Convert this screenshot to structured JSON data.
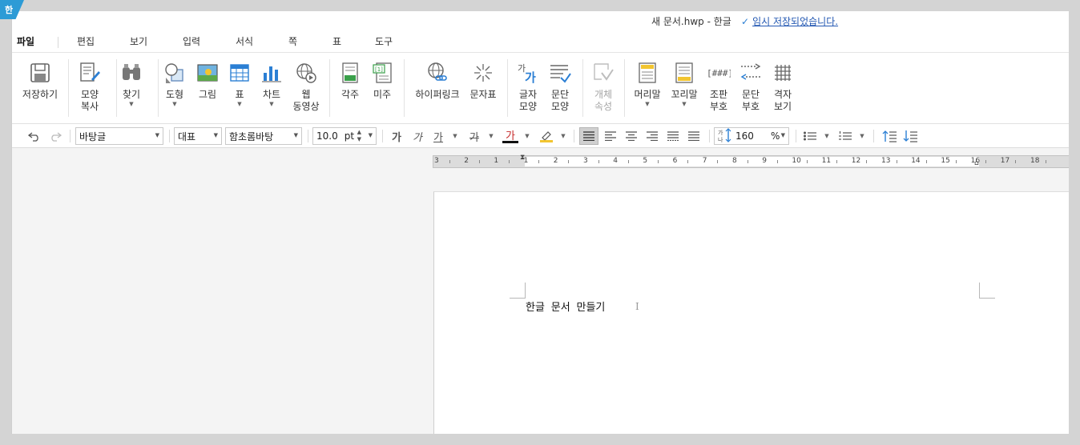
{
  "app": {
    "logo_text": "한"
  },
  "title": {
    "document": "새 문서.hwp - 한글",
    "save_status": "임시 저장되었습니다.",
    "accent_color": "#2d9bd6"
  },
  "menu": {
    "items": [
      {
        "label": "파일",
        "active": true
      },
      {
        "label": "편집"
      },
      {
        "label": "보기"
      },
      {
        "label": "입력"
      },
      {
        "label": "서식"
      },
      {
        "label": "쪽"
      },
      {
        "label": "표"
      },
      {
        "label": "도구"
      }
    ]
  },
  "ribbon": {
    "save_as": "저장하기",
    "shape_copy": "모양\n복사",
    "find": "찾기",
    "shape": "도형",
    "picture": "그림",
    "table": "표",
    "chart": "차트",
    "web_video": "웹\n동영상",
    "footnote": "각주",
    "endnote": "미주",
    "hyperlink": "하이퍼링크",
    "char_map": "문자표",
    "char_shape": "글자\n모양",
    "para_shape": "문단\n모양",
    "object_props": "개체\n속성",
    "header": "머리말",
    "footer": "꼬리말",
    "assembly": "조판\n부호",
    "para_mark": "문단\n부호",
    "grid": "격자\n보기"
  },
  "toolbar": {
    "style": "바탕글",
    "lang": "대표",
    "font": "함초롬바탕",
    "size": "10.0",
    "size_unit": "pt",
    "bold": "가",
    "italic": "가",
    "underline": "가",
    "strike": "가",
    "font_color": "가",
    "line_spacing": "160",
    "line_spacing_unit": "%"
  },
  "ruler": {
    "labels": [
      "3",
      "2",
      "1",
      "1",
      "2",
      "3",
      "4",
      "5",
      "6",
      "7",
      "8",
      "9",
      "10",
      "11",
      "12",
      "13",
      "14",
      "15",
      "16",
      "17",
      "18"
    ]
  },
  "document": {
    "text": "한글 문서 만들기"
  }
}
